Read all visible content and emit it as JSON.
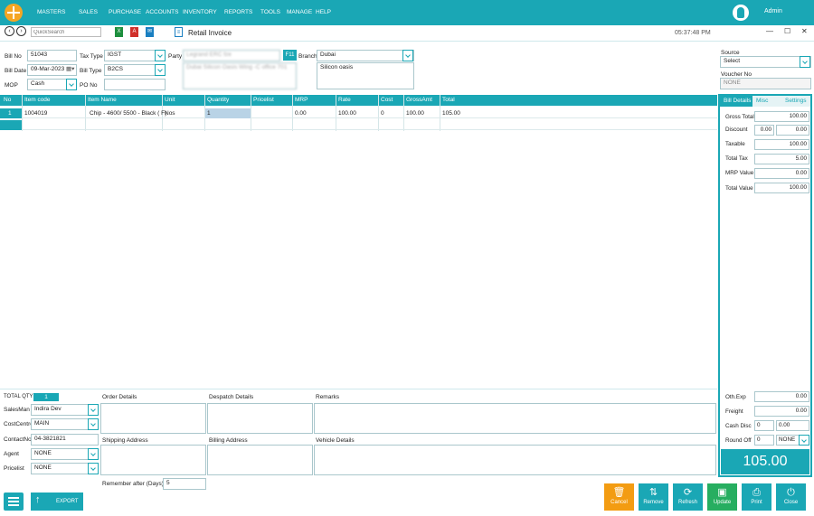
{
  "menu": [
    "MASTERS",
    "SALES",
    "PURCHASE",
    "ACCOUNTS",
    "INVENTORY",
    "REPORTS",
    "TOOLS",
    "MANAGE",
    "HELP"
  ],
  "user": "Admin",
  "toolbar": {
    "quicksearch_placeholder": "QuickSearch",
    "title": "Retail Invoice",
    "time": "05:37:48 PM",
    "win_min": "—",
    "win_max": "☐",
    "win_close": "✕"
  },
  "form": {
    "bill_no_label": "Bill No",
    "bill_no": "51043",
    "bill_date_label": "Bill Date",
    "bill_date": "09-Mar-2023",
    "mop_label": "MOP",
    "mop": "Cash",
    "tax_type_label": "Tax Type",
    "tax_type": "IGST",
    "bill_type_label": "Bill Type",
    "bill_type": "B2CS",
    "po_no_label": "PO No",
    "po_no": "",
    "party_label": "Party",
    "party": "Legrand ERC fze",
    "party_address": "Dubai Silicon Oasis Wing -C office 701",
    "f11": "F11",
    "branch_label": "Branch",
    "branch": "Dubai",
    "branch_address": "Silicon oasis",
    "source_label": "Source",
    "source": "Select",
    "voucher_label": "Voucher No",
    "voucher": "NONE"
  },
  "grid": {
    "headers": [
      "No",
      "Item code",
      "Item Name",
      "Unit",
      "Quantity",
      "Pricelist",
      "MRP",
      "Rate",
      "Cost",
      "GrossAmt",
      "Total"
    ],
    "rows": [
      [
        "1",
        "1004019",
        "Chip - 4600/ 5500 - Black ( F)",
        "Nos",
        "1",
        "",
        "0.00",
        "100.00",
        "0",
        "100.00",
        "105.00"
      ]
    ]
  },
  "right": {
    "tabs": [
      "Bill Details",
      "Misc",
      "Settings"
    ],
    "gross_label": "Gross Total",
    "gross": "100.00",
    "discount_label": "Discount",
    "disc_pct": "0.00",
    "disc_amt": "0.00",
    "taxable_label": "Taxable",
    "taxable": "100.00",
    "tax_label": "Total Tax",
    "tax": "5.00",
    "mrp_label": "MRP Value",
    "mrp": "0.00",
    "total_label": "Total Value",
    "total": "100.00",
    "othexp_label": "Oth.Exp",
    "othexp": "0.00",
    "freight_label": "Freight",
    "freight": "0.00",
    "cashdisc_label": "Cash Disc",
    "cashdisc_pct": "0",
    "cashdisc_amt": "0.00",
    "roundoff_label": "Round Off",
    "roundoff": "0",
    "roundoff_mode": "NONE",
    "grand": "105.00"
  },
  "bottom": {
    "total_qty_label": "TOTAL QTY",
    "total_qty": "1",
    "salesman_label": "SalesMan",
    "salesman": "Indira Dev",
    "costcentre_label": "CostCentre",
    "costcentre": "MAIN",
    "contact_label": "ContactNo",
    "contact": "04-3821821",
    "agent_label": "Agent",
    "agent": "NONE",
    "pricelist_label": "Pricelist",
    "pricelist": "NONE",
    "order_label": "Order Details",
    "despatch_label": "Despatch Details",
    "remarks_label": "Remarks",
    "shipping_label": "Shipping Address",
    "billing_label": "Billing Address",
    "vehicle_label": "Vehicle Details",
    "remember_label": "Remember after (Days)",
    "remember": "5"
  },
  "buttons": {
    "export": "EXPORT",
    "cancel": "Cancel",
    "remove": "Remove",
    "refresh": "Refresh",
    "update": "Update",
    "print": "Print",
    "close": "Close"
  },
  "colors": {
    "accent": "#1aa7b5",
    "cancel": "#f39c12",
    "update": "#27ae60"
  }
}
